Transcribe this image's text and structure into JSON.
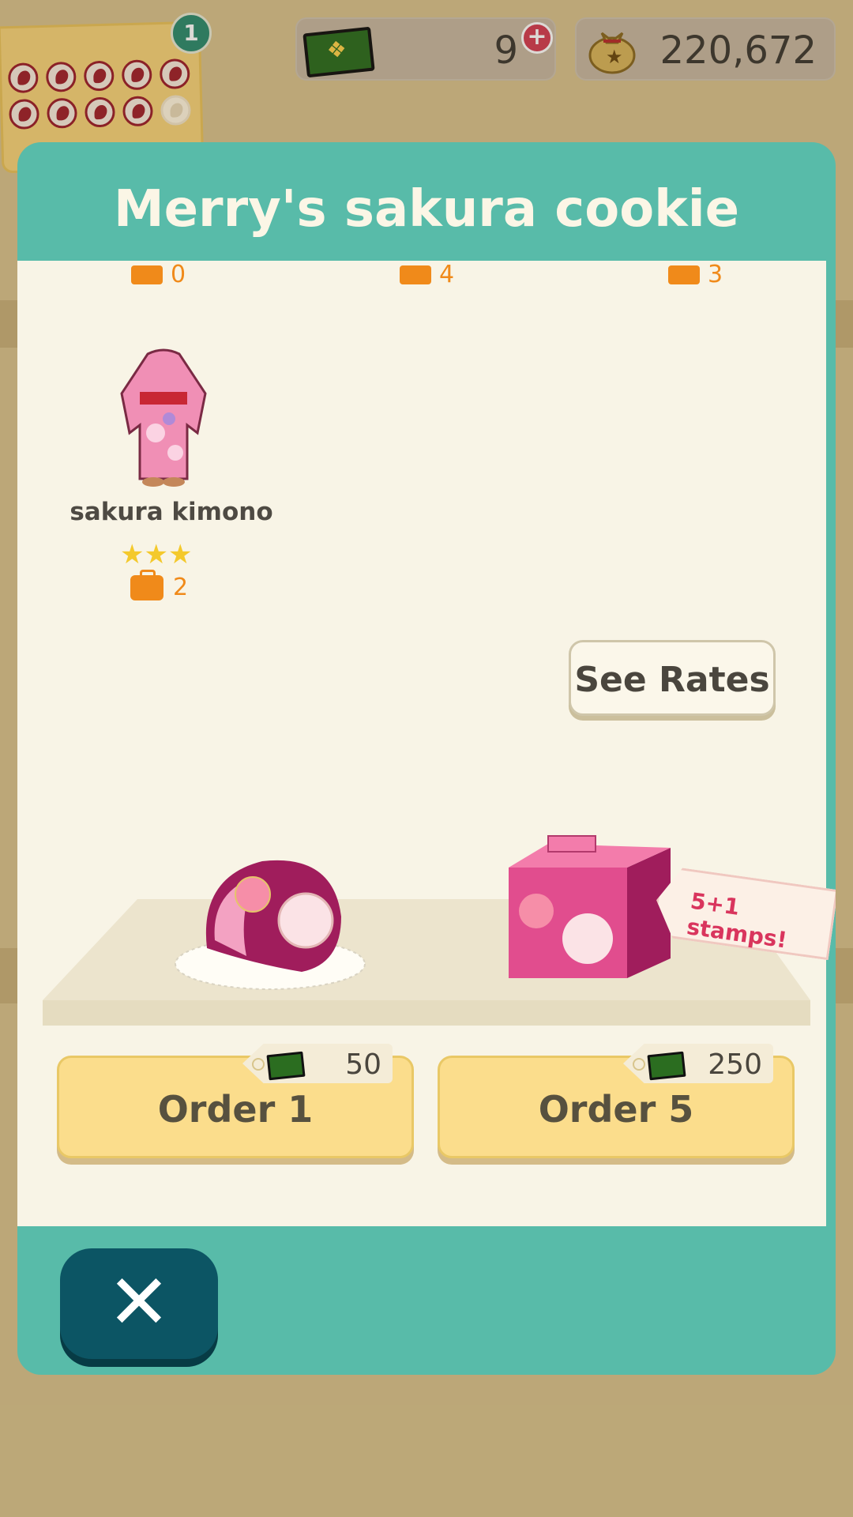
{
  "hud": {
    "stamp_badge": "1",
    "tickets": "9",
    "bells": "220,672"
  },
  "modal": {
    "title": "Merry's sakura cookie",
    "top_counts": [
      "0",
      "4",
      "3"
    ],
    "item": {
      "name": "sakura kimono",
      "stars": "★★★",
      "quantity": "2"
    },
    "see_rates": "See Rates",
    "box_tag": "5+1 stamps!",
    "orders": [
      {
        "label": "Order 1",
        "price": "50"
      },
      {
        "label": "Order 5",
        "price": "250"
      }
    ],
    "close_icon": "✕"
  },
  "colors": {
    "header_teal": "#58bba9",
    "panel_cream": "#f8f4e6",
    "button_yellow": "#fbdd8c",
    "close_dark_teal": "#0c5564",
    "orange": "#f08a1a"
  }
}
